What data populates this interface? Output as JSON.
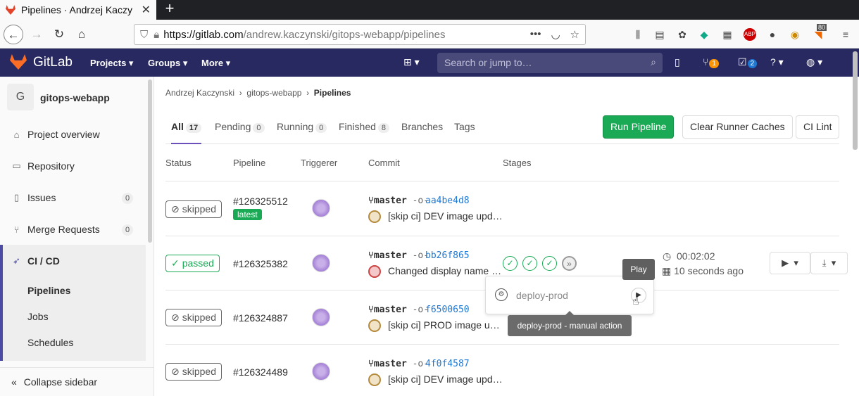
{
  "browser": {
    "tab_title": "Pipelines · Andrzej Kaczy",
    "url_host": "https://gitlab.com",
    "url_path": "/andrew.kaczynski/gitops-webapp/pipelines",
    "ext_badge": "80"
  },
  "header": {
    "brand": "GitLab",
    "nav": [
      "Projects",
      "Groups",
      "More"
    ],
    "search_placeholder": "Search or jump to…",
    "mr_count": "1",
    "todo_count": "2"
  },
  "sidebar": {
    "project_initial": "G",
    "project_name": "gitops-webapp",
    "items": [
      {
        "label": "Project overview"
      },
      {
        "label": "Repository"
      },
      {
        "label": "Issues",
        "count": "0"
      },
      {
        "label": "Merge Requests",
        "count": "0"
      },
      {
        "label": "CI / CD"
      }
    ],
    "cicd_sub": [
      "Pipelines",
      "Jobs",
      "Schedules"
    ],
    "collapse": "Collapse sidebar"
  },
  "breadcrumb": [
    "Andrzej Kaczynski",
    "gitops-webapp",
    "Pipelines"
  ],
  "tabs": [
    {
      "label": "All",
      "count": "17"
    },
    {
      "label": "Pending",
      "count": "0"
    },
    {
      "label": "Running",
      "count": "0"
    },
    {
      "label": "Finished",
      "count": "8"
    },
    {
      "label": "Branches"
    },
    {
      "label": "Tags"
    }
  ],
  "buttons": {
    "run": "Run Pipeline",
    "clear": "Clear Runner Caches",
    "lint": "CI Lint"
  },
  "columns": [
    "Status",
    "Pipeline",
    "Triggerer",
    "Commit",
    "Stages"
  ],
  "rows": [
    {
      "status": "skipped",
      "id": "#126325512",
      "tag": "latest",
      "branch": "master",
      "sha": "aa4be4d8",
      "message": "[skip ci] DEV image upd…"
    },
    {
      "status": "passed",
      "id": "#126325382",
      "branch": "master",
      "sha": "bb26f865",
      "message": "Changed display name …",
      "duration": "00:02:02",
      "ago": "10 seconds ago"
    },
    {
      "status": "skipped",
      "id": "#126324887",
      "branch": "master",
      "sha": "f6500650",
      "message": "[skip ci] PROD image u…"
    },
    {
      "status": "skipped",
      "id": "#126324489",
      "branch": "master",
      "sha": "4f0f4587",
      "message": "[skip ci] DEV image upd…"
    }
  ],
  "dropdown": {
    "job": "deploy-prod",
    "tooltip_play": "Play",
    "tooltip_job": "deploy-prod - manual action"
  }
}
